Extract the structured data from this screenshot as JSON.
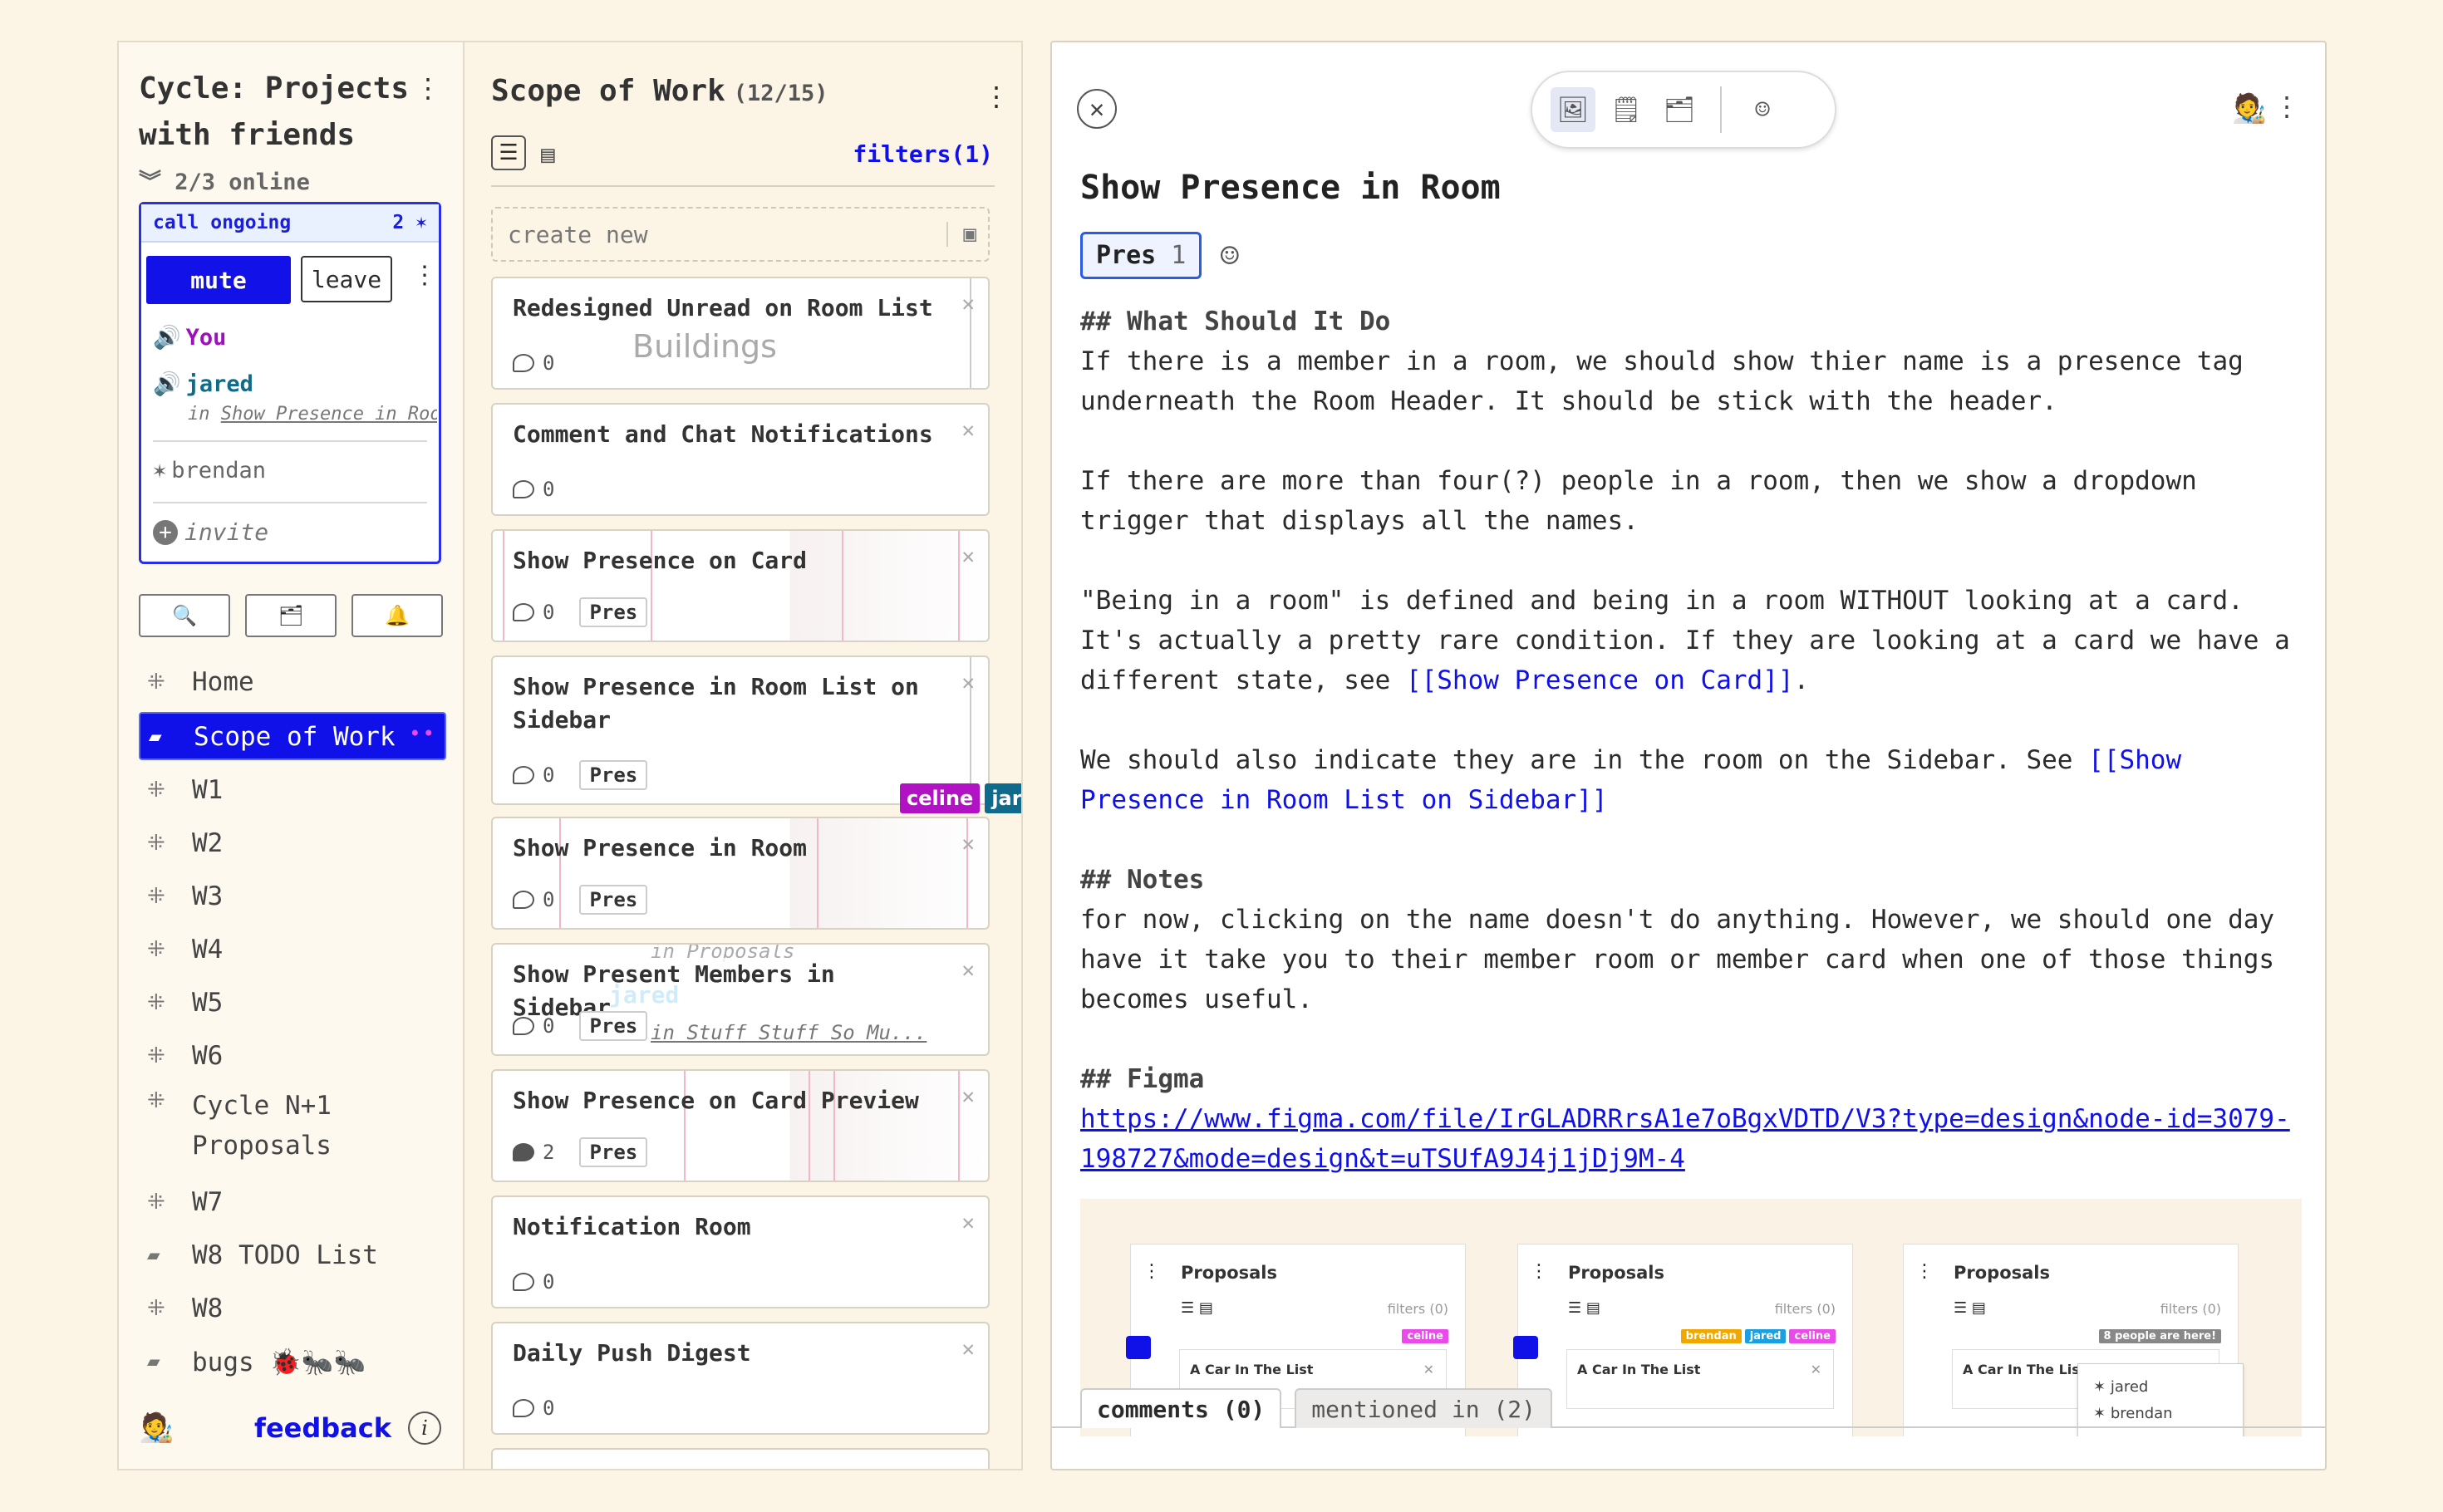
{
  "sidebar": {
    "cycle_title": "Cycle: Projects with friends",
    "online": "2/3 online",
    "call": {
      "status": "call ongoing",
      "count": "2",
      "mute_label": "mute",
      "leave_label": "leave",
      "members": {
        "you": "You",
        "jared": "jared",
        "jared_location_prefix": "in",
        "jared_location": "Show Presence in Room",
        "brendan": "brendan"
      },
      "invite_label": "invite"
    },
    "nav": [
      {
        "label": "Home",
        "icon": "grid-icon"
      },
      {
        "label": "Scope of Work",
        "icon": "cards-icon",
        "active": true
      },
      {
        "label": "W1",
        "icon": "grid-icon"
      },
      {
        "label": "W2",
        "icon": "grid-icon"
      },
      {
        "label": "W3",
        "icon": "grid-icon"
      },
      {
        "label": "W4",
        "icon": "grid-icon"
      },
      {
        "label": "W5",
        "icon": "grid-icon"
      },
      {
        "label": "W6",
        "icon": "grid-icon"
      },
      {
        "label": "Cycle N+1 Proposals",
        "icon": "grid-icon"
      },
      {
        "label": "W7",
        "icon": "grid-icon"
      },
      {
        "label": "W8 TODO List",
        "icon": "cards-icon"
      },
      {
        "label": "W8",
        "icon": "grid-icon"
      },
      {
        "label": "bugs 🐞🐜🐜",
        "icon": "cards-icon"
      }
    ],
    "feedback_label": "feedback",
    "info_label": "i"
  },
  "list": {
    "title": "Scope of Work",
    "count": "(12/15)",
    "filters_label": "filters(1)",
    "create_placeholder": "create new",
    "cards": [
      {
        "title": "Redesigned Unread on Room List",
        "comments": "0",
        "bg_text": "Buildings"
      },
      {
        "title": "Comment and Chat Notifications",
        "comments": "0"
      },
      {
        "title": "Show Presence on Card",
        "comments": "0",
        "tag": "Pres"
      },
      {
        "title": "Show Presence in Room List on Sidebar",
        "comments": "0",
        "tag": "Pres"
      },
      {
        "title": "Show Presence in Room",
        "comments": "0",
        "tag": "Pres"
      },
      {
        "title": "Show Present Members in Sidebar",
        "comments": "0",
        "tag": "Pres",
        "bg_text_1": "in Proposals",
        "bg_text_2": "jared",
        "bg_text_3": "in Stuff Stuff So Mu..."
      },
      {
        "title": "Show Presence on Card Preview",
        "comments": "2",
        "tag": "Pres"
      },
      {
        "title": "Notification Room",
        "comments": "0"
      },
      {
        "title": "Daily Push Digest",
        "comments": "0"
      }
    ],
    "presence_tags": [
      {
        "name": "celine",
        "color": "#b012c4"
      },
      {
        "name": "jared",
        "color": "#0f6a8c"
      }
    ]
  },
  "detail": {
    "title": "Show Presence in Room",
    "tag_label": "Pres",
    "tag_count": "1",
    "sections": {
      "h1": "## What Should It Do",
      "p1": "If there is a member in a room, we should show thier name is a presence tag underneath the Room Header. It should be stick with the header.",
      "p2": "If there are more than four(?) people in a room, then we show a dropdown trigger that displays all the names.",
      "p3_a": "\"Being in a room\" is defined and being in a room WITHOUT looking at a card. It's actually a pretty rare condition. If they are looking at a card we have a different state, see ",
      "p3_link": "[[Show Presence on Card]]",
      "p3_b": ".",
      "p4_a": "We should also indicate they are in the room on the Sidebar. See ",
      "p4_link": "[[Show Presence in Room List on Sidebar]]",
      "h2": "## Notes",
      "p5": "for now, clicking on the name doesn't do anything. However, we should one day have it take you to their member room or member card when one of those things becomes useful.",
      "h3": "## Figma",
      "figma_url": "https://www.figma.com/file/IrGLADRRrsA1e7oBgxVDTD/V3?type=design&node-id=3079-198727&mode=design&t=uTSUfA9J4j1jDj9M-4"
    },
    "figma_preview": {
      "panel_title": "Proposals",
      "filters": "filters (0)",
      "card_title": "A Car In The List",
      "tags_1": [
        "celine"
      ],
      "tags_2": [
        "brendan",
        "jared",
        "celine"
      ],
      "here_badge": "8 people are here!",
      "dropdown": [
        "jared",
        "brendan"
      ]
    },
    "tabs": {
      "comments": "comments (0)",
      "mentioned": "mentioned in (2)"
    }
  }
}
